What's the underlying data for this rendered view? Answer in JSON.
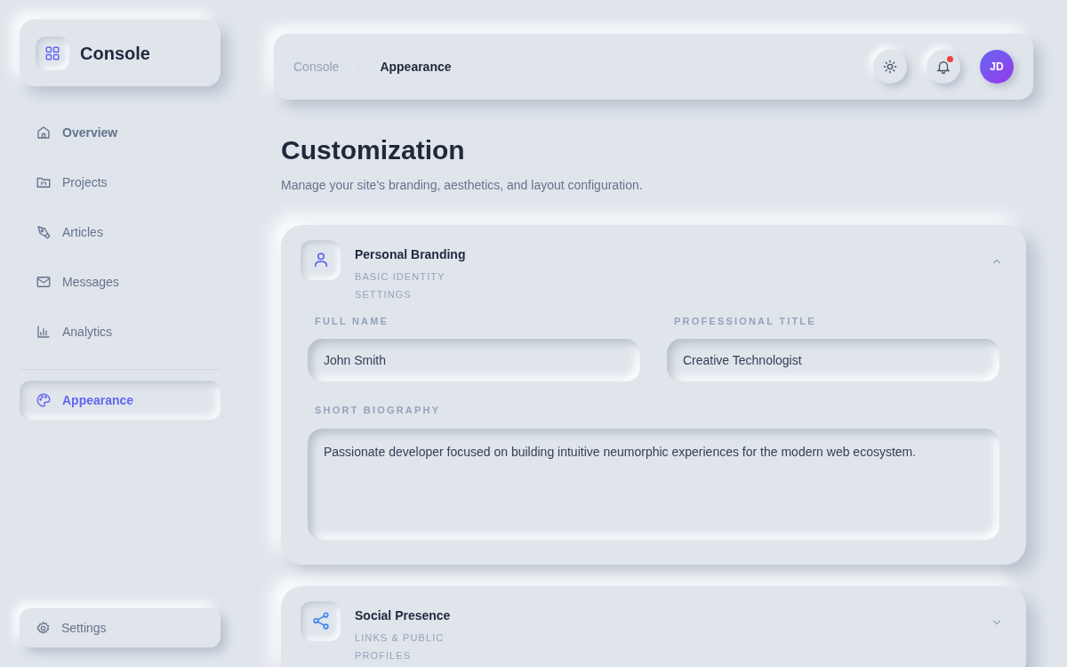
{
  "brand": {
    "name": "Console"
  },
  "nav": [
    {
      "label": "Overview",
      "selected": false,
      "bold": true
    },
    {
      "label": "Projects",
      "selected": false,
      "bold": false
    },
    {
      "label": "Articles",
      "selected": false,
      "bold": false
    },
    {
      "label": "Messages",
      "selected": false,
      "bold": false
    },
    {
      "label": "Analytics",
      "selected": false,
      "bold": false
    },
    {
      "label": "Appearance",
      "selected": true,
      "bold": true
    }
  ],
  "settings": {
    "label": "Settings"
  },
  "breadcrumb": [
    {
      "label": "Console",
      "selected": false
    },
    {
      "label": "Appearance",
      "selected": true
    }
  ],
  "header": {
    "notifications_unread": true,
    "avatar": "JD"
  },
  "page": {
    "title": "Customization",
    "subtitle": "Manage your site's branding, aesthetics, and layout configuration."
  },
  "sections": [
    {
      "title": "Personal Branding",
      "subtitle": "BASIC IDENTITY SETTINGS",
      "expanded": true,
      "fields": [
        {
          "kind": "input",
          "label": "FULL NAME",
          "value": "John Smith"
        },
        {
          "kind": "input",
          "label": "PROFESSIONAL TITLE",
          "value": "Creative Technologist"
        },
        {
          "kind": "textarea",
          "label": "SHORT BIOGRAPHY",
          "value": "Passionate developer focused on building intuitive neumorphic experiences for the modern web ecosystem."
        }
      ]
    },
    {
      "title": "Social Presence",
      "subtitle": "LINKS & PUBLIC PROFILES",
      "expanded": false
    }
  ]
}
